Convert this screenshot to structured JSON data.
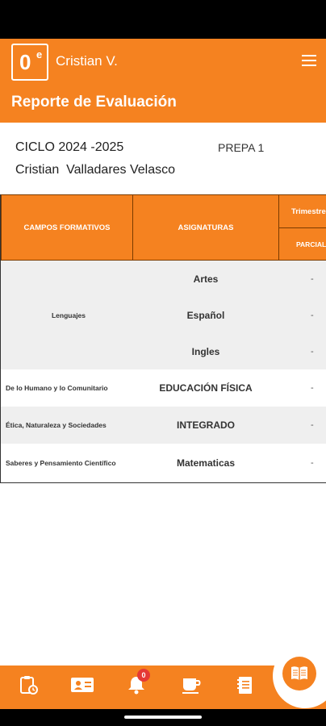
{
  "header": {
    "logo_text": "0",
    "logo_superscript": "e",
    "user_name": "Cristian V.",
    "page_title": "Reporte de Evaluación"
  },
  "info": {
    "ciclo": "CICLO 2024 -2025",
    "grado": "PREPA 1",
    "student_name": "Cristian  Valladares Velasco"
  },
  "table": {
    "headers": {
      "campos": "CAMPOS FORMATIVOS",
      "asignaturas": "ASIGNATURAS",
      "trimestre": "Trimestre",
      "parcial": "PARCIAL"
    },
    "rows": [
      {
        "campo": "Lenguajes",
        "subject": "Artes",
        "grade": "-"
      },
      {
        "campo": "",
        "subject": "Español",
        "grade": "-"
      },
      {
        "campo": "",
        "subject": "Ingles",
        "grade": "-"
      },
      {
        "campo": "De lo Humano y lo Comunitario",
        "subject": "EDUCACIÓN FÍSICA",
        "grade": "-"
      },
      {
        "campo": "Ética, Naturaleza y Sociedades",
        "subject": "INTEGRADO",
        "grade": "-"
      },
      {
        "campo": "Saberes y Pensamiento Científico",
        "subject": "Matematicas",
        "grade": "-"
      }
    ]
  },
  "bottom_nav": {
    "items": [
      {
        "icon": "clipboard-clock-icon"
      },
      {
        "icon": "contact-card-icon"
      },
      {
        "icon": "bell-icon",
        "badge": "0"
      },
      {
        "icon": "coffee-cup-icon"
      },
      {
        "icon": "notebook-icon"
      }
    ],
    "fab_icon": "open-book-icon"
  },
  "colors": {
    "primary": "#f58220",
    "shaded_row": "#efefef",
    "badge": "#e53935"
  }
}
